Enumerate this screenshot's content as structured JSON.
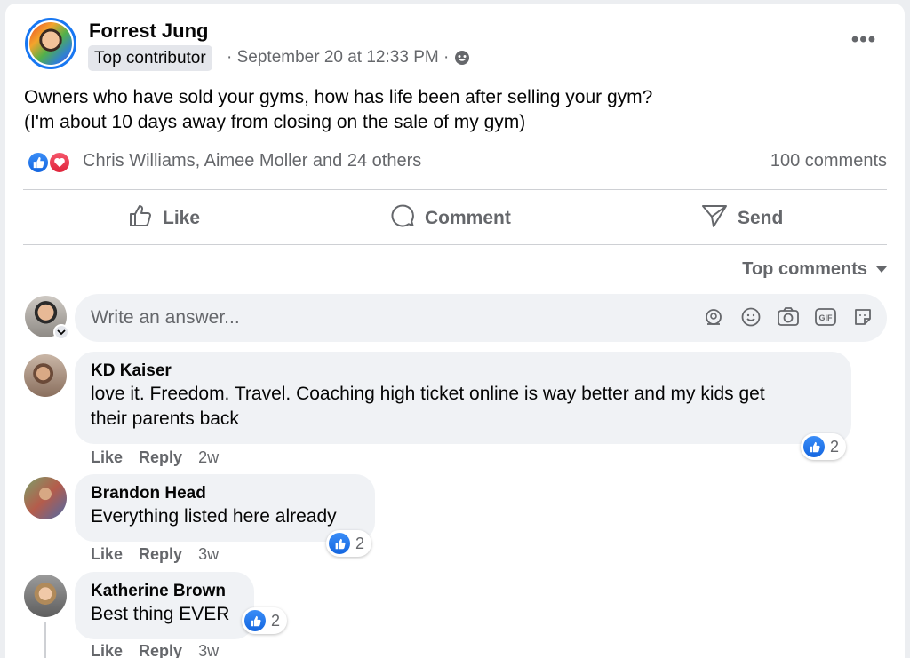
{
  "post": {
    "author": "Forrest Jung",
    "badge": "Top contributor",
    "meta": "· September 20 at 12:33 PM ·",
    "audience_icon": "group-audience-icon",
    "text_line1": "Owners who have sold your gyms, how has life been after selling your gym?",
    "text_line2": "(I'm about 10 days away from closing on the sale of my gym)",
    "reactions": {
      "icons": [
        "like-reaction-icon",
        "love-reaction-icon"
      ],
      "names": "Chris Williams, Aimee Moller and 24 others"
    },
    "comments_count": "100 comments"
  },
  "actions": {
    "like": "Like",
    "comment": "Comment",
    "send": "Send"
  },
  "sort_label": "Top comments",
  "composer": {
    "placeholder": "Write an answer...",
    "tools": [
      "avatar-sticker-icon",
      "emoji-icon",
      "camera-icon",
      "gif-icon",
      "sticker-icon"
    ]
  },
  "comments": [
    {
      "name": "KD Kaiser",
      "text_line1": "love it. Freedom. Travel. Coaching high ticket online is way better and my kids get",
      "text_line2": "their parents back",
      "like": "Like",
      "reply": "Reply",
      "time": "2w",
      "reaction_count": "2"
    },
    {
      "name": "Brandon Head",
      "text_line1": "Everything listed here already",
      "like": "Like",
      "reply": "Reply",
      "time": "3w",
      "reaction_count": "2"
    },
    {
      "name": "Katherine Brown",
      "text_line1": "Best thing EVER",
      "like": "Like",
      "reply": "Reply",
      "time": "3w",
      "reaction_count": "2"
    }
  ],
  "colors": {
    "accent": "#1877f2",
    "love": "#f02849",
    "secondary_text": "#65676b",
    "bubble": "#f0f2f5"
  }
}
